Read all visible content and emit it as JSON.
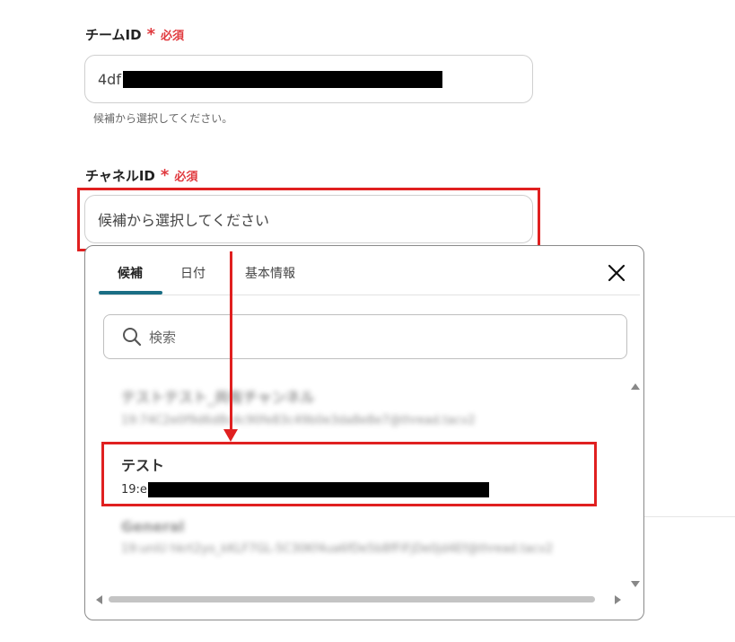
{
  "team": {
    "label": "チームID",
    "required_mark": "*",
    "required_text": "必須",
    "value_prefix": "4df",
    "hint": "候補から選択してください。"
  },
  "channel": {
    "label": "チャネルID",
    "required_mark": "*",
    "required_text": "必須",
    "placeholder": "候補から選択してください"
  },
  "popup": {
    "tabs": [
      {
        "label": "候補"
      },
      {
        "label": "日付"
      },
      {
        "label": "基本情報"
      }
    ],
    "search_placeholder": "検索",
    "items": [
      {
        "name": "テストテスト_共有チャンネル",
        "id": "19:74C2e0f9d6d8c4c90fe83c49b0e3da8e8e7@thread.tacv2"
      },
      {
        "name": "テスト",
        "id_prefix": "19:e"
      },
      {
        "name": "General",
        "id": "19:uniU hkrt2yo_kKLF7GL-5C30Kf4ua6fDe5b8fFlFjDe0jd4Ef@thread.tacv2"
      }
    ]
  },
  "colors": {
    "accent": "#1a6e85",
    "required": "#e0393e",
    "highlight": "#e02020"
  }
}
